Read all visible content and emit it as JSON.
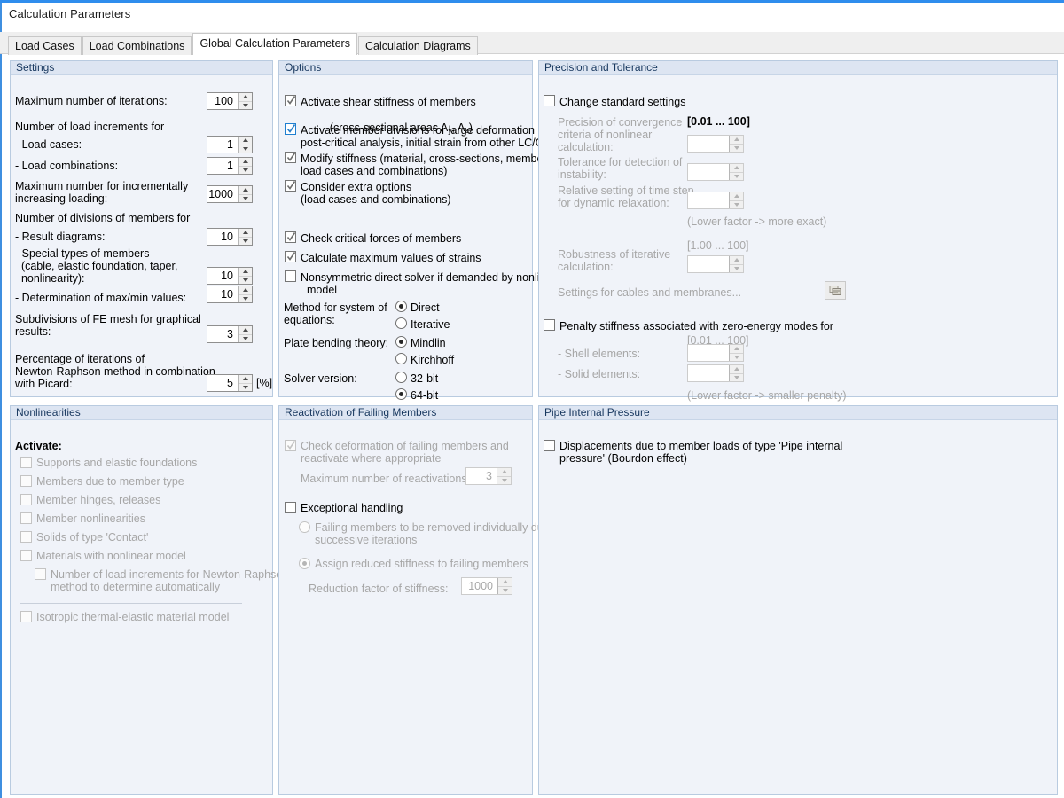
{
  "window": {
    "title": "Calculation Parameters",
    "accent_color": "#2f8ded"
  },
  "tabs": [
    {
      "label": "Load Cases",
      "active": false
    },
    {
      "label": "Load Combinations",
      "active": false
    },
    {
      "label": "Global Calculation Parameters",
      "active": true
    },
    {
      "label": "Calculation Diagrams",
      "active": false
    }
  ],
  "settings": {
    "header": "Settings",
    "max_iterations_label": "Maximum number of iterations:",
    "max_iterations_value": "100",
    "load_increments_heading": "Number of load increments for",
    "load_cases_label": "- Load cases:",
    "load_cases_value": "1",
    "load_combinations_label": "- Load combinations:",
    "load_combinations_value": "1",
    "incremental_label_l1": "Maximum number for incrementally",
    "incremental_label_l2": "increasing loading:",
    "incremental_value": "1000",
    "divisions_heading": "Number of divisions of members for",
    "result_diagrams_label": "- Result diagrams:",
    "result_diagrams_value": "10",
    "special_members_l1": "- Special types of members",
    "special_members_l2": "  (cable, elastic foundation, taper,",
    "special_members_l3": "  nonlinearity):",
    "special_members_value": "10",
    "maxmin_label": "- Determination of max/min values:",
    "maxmin_value": "10",
    "fe_mesh_l1": "Subdivisions of FE mesh for graphical",
    "fe_mesh_l2": "results:",
    "fe_mesh_value": "3",
    "picard_l1": "Percentage of iterations of",
    "picard_l2": "Newton-Raphson method in combination",
    "picard_l3": "with Picard:",
    "picard_value": "5",
    "picard_unit": "[%]"
  },
  "options": {
    "header": "Options",
    "shear_stiffness_l1": "Activate shear stiffness of members",
    "shear_stiffness_l2_pre": "(cross-sectional areas A",
    "shear_stiffness_sub1": "y",
    "shear_stiffness_mid": ", A",
    "shear_stiffness_sub2": "z",
    "shear_stiffness_l2_post": ")",
    "shear_stiffness_checked": true,
    "member_divisions_l1": "Activate member divisions for large deformation or",
    "member_divisions_l2": "post-critical analysis, initial strain from other LC/CO",
    "member_divisions_checked": true,
    "member_divisions_focused": true,
    "modify_stiffness_l1": "Modify stiffness (material, cross-sections, members,",
    "modify_stiffness_l2": "load cases and combinations)",
    "modify_stiffness_checked": true,
    "extra_options_l1": "Consider extra options",
    "extra_options_l2": "(load cases and combinations)",
    "extra_options_checked": true,
    "critical_forces_label": "Check critical forces of members",
    "critical_forces_checked": true,
    "max_strains_label": "Calculate maximum values of strains",
    "max_strains_checked": true,
    "nonsymmetric_l1": "Nonsymmetric direct solver if demanded by nonlinear",
    "nonsymmetric_l2": "model",
    "nonsymmetric_checked": false,
    "method_label_l1": "Method for system of",
    "method_label_l2": "equations:",
    "method_options": [
      {
        "label": "Direct",
        "selected": true
      },
      {
        "label": "Iterative",
        "selected": false
      }
    ],
    "plate_label": "Plate bending theory:",
    "plate_options": [
      {
        "label": "Mindlin",
        "selected": true
      },
      {
        "label": "Kirchhoff",
        "selected": false
      }
    ],
    "solver_label": "Solver version:",
    "solver_options": [
      {
        "label": "32-bit",
        "selected": false
      },
      {
        "label": "64-bit",
        "selected": true
      }
    ]
  },
  "precision": {
    "header": "Precision and Tolerance",
    "change_standard_label": "Change standard settings",
    "change_standard_checked": false,
    "convergence_l1": "Precision of convergence",
    "convergence_l2": "criteria of nonlinear",
    "convergence_l3": "calculation:",
    "convergence_range": "[0.01 ... 100]",
    "convergence_value": "",
    "instability_l1": "Tolerance for detection of",
    "instability_l2": "instability:",
    "instability_value": "",
    "timestep_l1": "Relative setting of time step",
    "timestep_l2": "for dynamic relaxation:",
    "timestep_value": "",
    "lower_factor_exact": "(Lower factor -> more exact)",
    "robustness_range": "[1.00 ... 100]",
    "robustness_l1": "Robustness of iterative",
    "robustness_l2": "calculation:",
    "robustness_value": "",
    "cables_membranes_label": "Settings for cables and membranes...",
    "penalty_label": "Penalty stiffness associated with zero-energy modes for",
    "penalty_checked": false,
    "penalty_range": "[0.01 ... 100]",
    "shell_label": "- Shell elements:",
    "shell_value": "",
    "solid_label": "- Solid elements:",
    "solid_value": "",
    "lower_factor_penalty": "(Lower factor -> smaller penalty)"
  },
  "nonlinearities": {
    "header": "Nonlinearities",
    "activate_label": "Activate:",
    "items": [
      {
        "label": "Supports and elastic foundations",
        "checked": false
      },
      {
        "label": "Members due to member type",
        "checked": false
      },
      {
        "label": "Member hinges, releases",
        "checked": false
      },
      {
        "label": "Member nonlinearities",
        "checked": false
      },
      {
        "label": "Solids of type 'Contact'",
        "checked": false
      },
      {
        "label": "Materials with nonlinear model",
        "checked": false
      }
    ],
    "newton_raphson_l1": "Number of load increments for Newton-Raphson",
    "newton_raphson_l2": "method to determine automatically",
    "newton_raphson_checked": false,
    "isotropic_label": "Isotropic thermal-elastic material model",
    "isotropic_checked": false
  },
  "reactivation": {
    "header": "Reactivation of Failing Members",
    "check_deformation_l1": "Check deformation of failing members and",
    "check_deformation_l2": "reactivate where appropriate",
    "check_deformation_checked": true,
    "max_reactivations_label": "Maximum number of reactivations:",
    "max_reactivations_value": "3",
    "exceptional_label": "Exceptional handling",
    "exceptional_checked": false,
    "remove_individually_l1": "Failing members to be removed individually during",
    "remove_individually_l2": "successive iterations",
    "remove_individually_selected": false,
    "reduced_stiffness_label": "Assign reduced stiffness to failing members",
    "reduced_stiffness_selected": true,
    "reduction_factor_label": "Reduction factor of stiffness:",
    "reduction_factor_value": "1000"
  },
  "pipe": {
    "header": "Pipe Internal Pressure",
    "displacements_l1": "Displacements due to member loads of type 'Pipe internal",
    "displacements_l2": "pressure' (Bourdon effect)",
    "displacements_checked": false
  }
}
